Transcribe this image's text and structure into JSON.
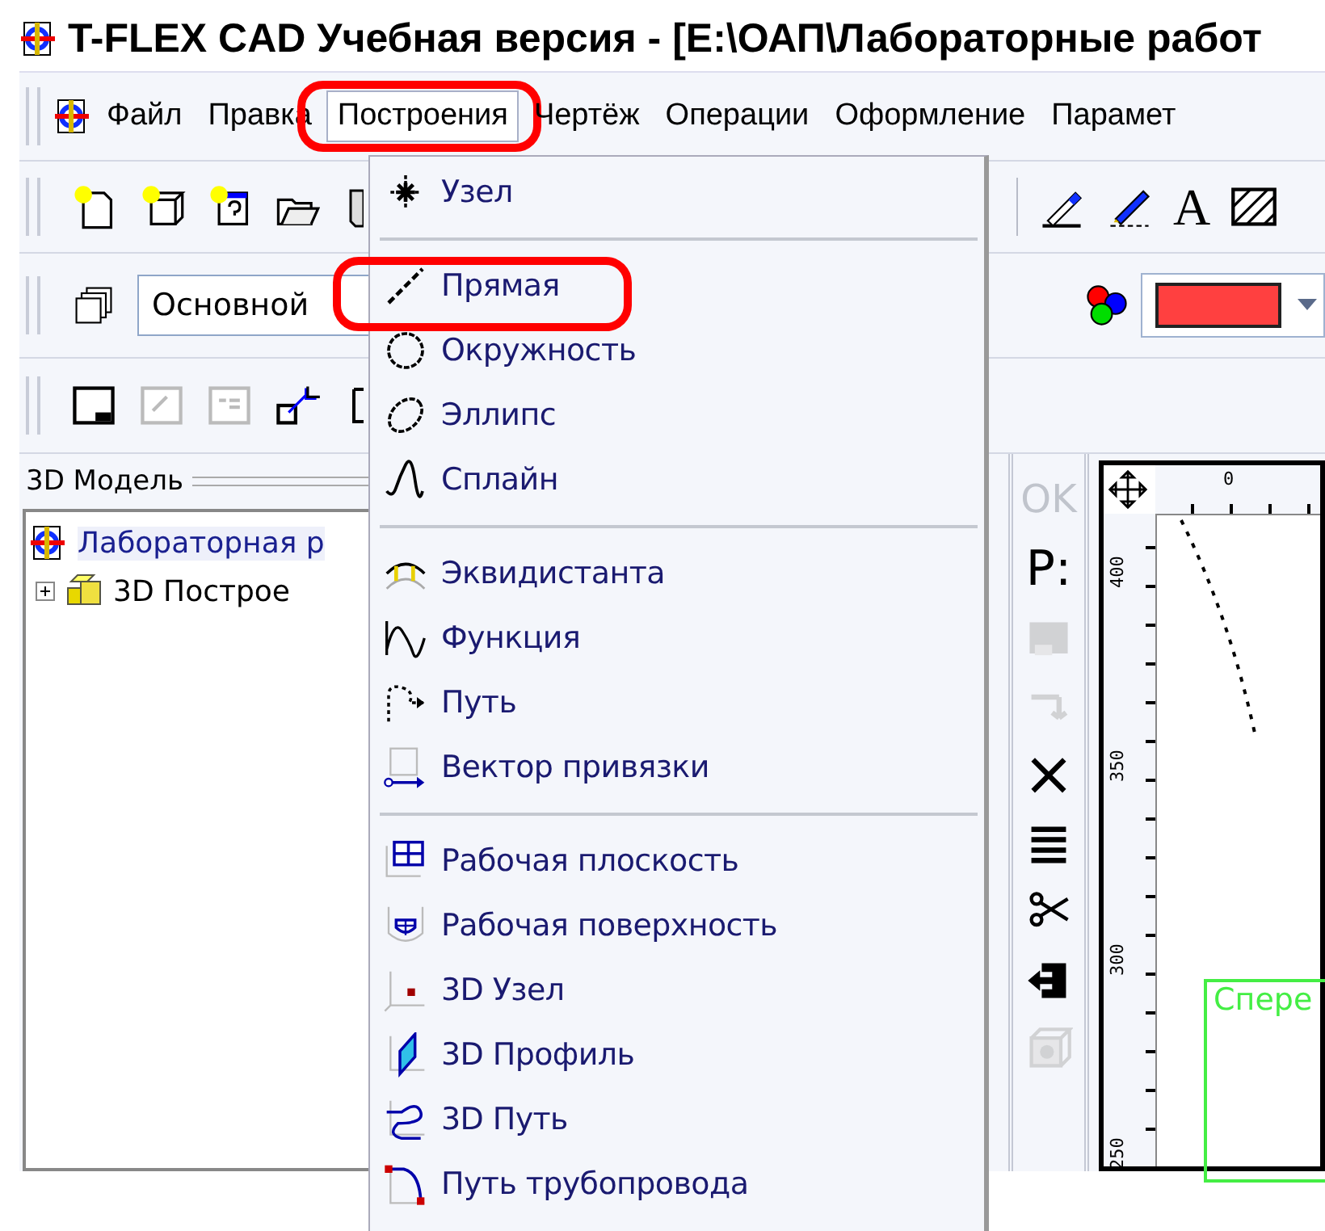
{
  "window": {
    "title": "T-FLEX CAD Учебная версия - [E:\\ОАП\\Лабораторные работ"
  },
  "menu_bar": [
    {
      "label": "Файл",
      "selected": false,
      "circled": false
    },
    {
      "label": "Правка",
      "selected": false,
      "circled": false
    },
    {
      "label": "Построения",
      "selected": true,
      "circled": true
    },
    {
      "label": "Чертёж",
      "selected": false,
      "circled": false
    },
    {
      "label": "Операции",
      "selected": false,
      "circled": false
    },
    {
      "label": "Оформление",
      "selected": false,
      "circled": false
    },
    {
      "label": "Парамет",
      "selected": false,
      "circled": false
    }
  ],
  "text_tool": {
    "label": "A"
  },
  "layer_combo": {
    "value": "Основной"
  },
  "color_combo": {
    "color": "#ff4040"
  },
  "model_panel": {
    "title": "3D Модель",
    "tree": [
      {
        "label": "Лабораторная р",
        "children": [
          {
            "label": "3D Построе",
            "expanded": false
          }
        ]
      }
    ]
  },
  "dropdown": [
    {
      "kind": "item",
      "label": "Узел",
      "circled": false
    },
    {
      "kind": "separator"
    },
    {
      "kind": "item",
      "label": "Прямая",
      "circled": true
    },
    {
      "kind": "item",
      "label": "Окружность",
      "circled": false
    },
    {
      "kind": "item",
      "label": "Эллипс",
      "circled": false
    },
    {
      "kind": "item",
      "label": "Сплайн",
      "circled": false
    },
    {
      "kind": "separator"
    },
    {
      "kind": "item",
      "label": "Эквидистанта",
      "circled": false
    },
    {
      "kind": "item",
      "label": "Функция",
      "circled": false
    },
    {
      "kind": "item",
      "label": "Путь",
      "circled": false
    },
    {
      "kind": "item",
      "label": "Вектор привязки",
      "circled": false
    },
    {
      "kind": "separator"
    },
    {
      "kind": "item",
      "label": "Рабочая плоскость",
      "circled": false
    },
    {
      "kind": "item",
      "label": "Рабочая поверхность",
      "circled": false
    },
    {
      "kind": "item",
      "label": "3D Узел",
      "circled": false
    },
    {
      "kind": "item",
      "label": "3D Профиль",
      "circled": false
    },
    {
      "kind": "item",
      "label": "3D Путь",
      "circled": false
    },
    {
      "kind": "item",
      "label": "Путь трубопровода",
      "circled": false
    }
  ],
  "command_bar": [
    {
      "kind": "text",
      "label": "OK",
      "disabled": true
    },
    {
      "kind": "text",
      "label": "P:",
      "disabled": false
    },
    {
      "kind": "icon",
      "disabled": true
    },
    {
      "kind": "icon",
      "disabled": true
    },
    {
      "kind": "icon",
      "disabled": false
    },
    {
      "kind": "icon",
      "disabled": false
    },
    {
      "kind": "icon",
      "disabled": false
    },
    {
      "kind": "icon",
      "disabled": false
    },
    {
      "kind": "icon",
      "disabled": true
    }
  ],
  "drawing": {
    "top_ruler": [
      "0"
    ],
    "left_ruler": [
      "400",
      "350",
      "300",
      "250"
    ],
    "frame_label": "Спере"
  }
}
